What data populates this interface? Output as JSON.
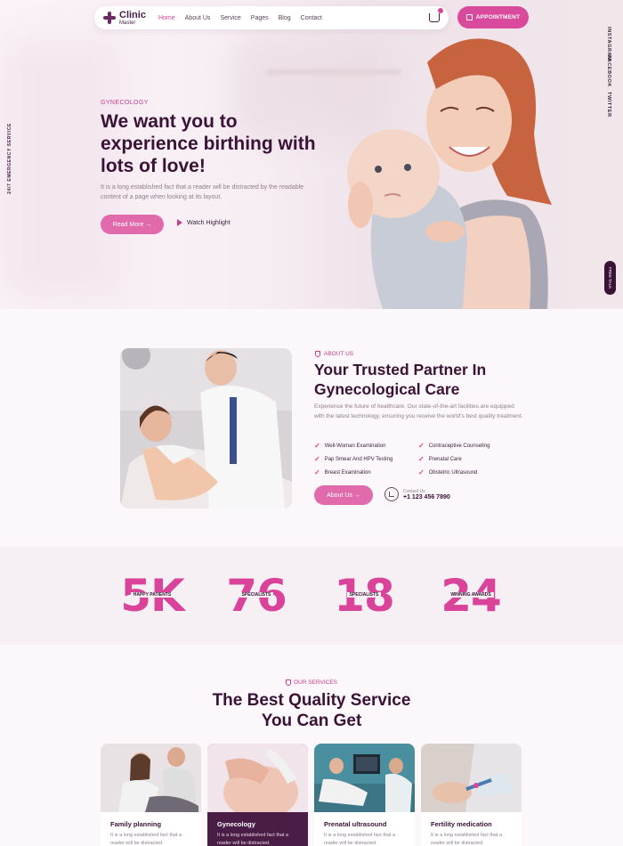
{
  "nav": {
    "logo_line1": "Clinic",
    "logo_line2": "Master",
    "links": [
      "Home",
      "About Us",
      "Service",
      "Pages",
      "Blog",
      "Contact"
    ],
    "active": "Home",
    "appointment_label": "APPOINTMENT"
  },
  "side": {
    "social": [
      "INSTAGRAM",
      "FACEBOOK",
      "TWITTER"
    ],
    "emergency": "24/7 EMERGENCY SERVICE",
    "pill": "FREE TALK"
  },
  "hero": {
    "kicker": "GYNECOLOGY",
    "title": "We want you to experience birthing with lots of love!",
    "desc": "It is a long established fact that a reader will be distracted by the readable content of a page when looking at its layout.",
    "read_more": "Read More →",
    "watch": "Watch Highlight"
  },
  "about": {
    "kicker": "ABOUT US",
    "title": "Your Trusted Partner In Gynecological Care",
    "desc": "Experience the future of healthcare. Our state-of-the-art facilities are equipped with the latest technology, ensuring you receive the world's best quality treatment.",
    "features": [
      "Well-Woman Examination",
      "Contraceptive Counseling",
      "Pap Smear And HPV Testing",
      "Prenatal Care",
      "Breast Examination",
      "Obstetric Ultrasound"
    ],
    "button": "About Us →",
    "contact_label": "Contact Us",
    "contact_number": "+1 123 456 7890"
  },
  "stats": [
    {
      "value": "5K",
      "label": "HAPPY PATIENTS"
    },
    {
      "value": "76",
      "label": "SPECIALISTS"
    },
    {
      "value": "18",
      "label": "SPECIALISTS"
    },
    {
      "value": "24",
      "label": "WINNING AWARDS"
    }
  ],
  "services": {
    "kicker": "OUR SERVICES",
    "title_line1": "The Best Quality Service",
    "title_line2": "You Can Get",
    "cards": [
      {
        "title": "Family planning",
        "desc": "It is a long established fact that a reader will be distracted."
      },
      {
        "title": "Gynecology",
        "desc": "It is a long established fact that a reader will be distracted."
      },
      {
        "title": "Prenatal ultrasound",
        "desc": "It is a long established fact that a reader will be distracted."
      },
      {
        "title": "Fertility medication",
        "desc": "It is a long established fact that a reader will be distracted."
      }
    ]
  },
  "colors": {
    "accent": "#d9449a",
    "dark": "#3a1236"
  }
}
